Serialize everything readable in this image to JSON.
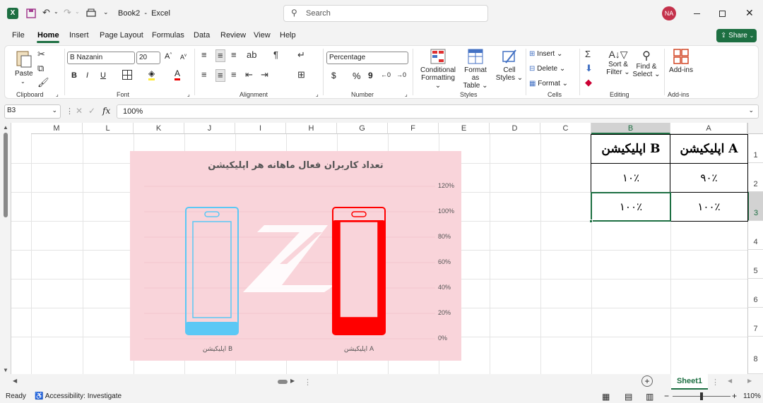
{
  "window": {
    "book_title": "Book2",
    "app_name": "Excel",
    "search_placeholder": "Search",
    "user_initials": "NA"
  },
  "menu": {
    "items": [
      "File",
      "Home",
      "Insert",
      "Page Layout",
      "Formulas",
      "Data",
      "Review",
      "View",
      "Help"
    ],
    "active": "Home",
    "share_label": "Share"
  },
  "ribbon": {
    "clipboard": {
      "paste_label": "Paste",
      "group_label": "Clipboard"
    },
    "font": {
      "family": "B Nazanin",
      "size": "20",
      "group_label": "Font",
      "bold": "B",
      "italic": "I",
      "underline": "U"
    },
    "alignment": {
      "group_label": "Alignment"
    },
    "number": {
      "format": "Percentage",
      "group_label": "Number",
      "dollar": "$",
      "percent": "%",
      "comma": "9"
    },
    "styles": {
      "conditional_1": "Conditional",
      "conditional_2": "Formatting",
      "table_1": "Format as",
      "table_2": "Table",
      "cell_1": "Cell",
      "cell_2": "Styles",
      "group_label": "Styles"
    },
    "cells": {
      "insert": "Insert",
      "delete": "Delete",
      "format": "Format",
      "group_label": "Cells"
    },
    "editing": {
      "sort_1": "Sort &",
      "sort_2": "Filter",
      "find_1": "Find &",
      "find_2": "Select",
      "group_label": "Editing"
    },
    "addins": {
      "label": "Add-ins",
      "group_label": "Add-ins"
    }
  },
  "formula_bar": {
    "name_box": "B3",
    "fx": "fx",
    "formula": "100%"
  },
  "sheet": {
    "columns": [
      "M",
      "L",
      "K",
      "J",
      "I",
      "H",
      "G",
      "F",
      "E",
      "D",
      "C",
      "B",
      "A"
    ],
    "rows": [
      "1",
      "2",
      "3",
      "4",
      "5",
      "6",
      "7",
      "8"
    ],
    "cells": {
      "A1": "اپلیکیشن A",
      "B1": "اپلیکیشن B",
      "A2": "۹۰٪",
      "B2": "۱۰٪",
      "A3": "۱۰۰٪",
      "B3": "۱۰۰٪"
    }
  },
  "chart_data": {
    "type": "bar",
    "title": "تعداد کاربران فعال ماهانه هر اپلیکیشن",
    "categories": [
      "اپلیکیشن A",
      "اپلیکیشن B"
    ],
    "series": [
      {
        "values": [
          90,
          10
        ]
      }
    ],
    "y_ticks": [
      "0%",
      "20%",
      "40%",
      "60%",
      "80%",
      "100%",
      "120%"
    ],
    "ylim": [
      0,
      120
    ],
    "colors": {
      "A": "#ff0000",
      "B": "#5bc8f5",
      "background": "#f9d4da"
    },
    "grid": true
  },
  "tabs": {
    "sheet": "Sheet1"
  },
  "status": {
    "ready": "Ready",
    "accessibility": "Accessibility: Investigate",
    "zoom": "110%"
  }
}
